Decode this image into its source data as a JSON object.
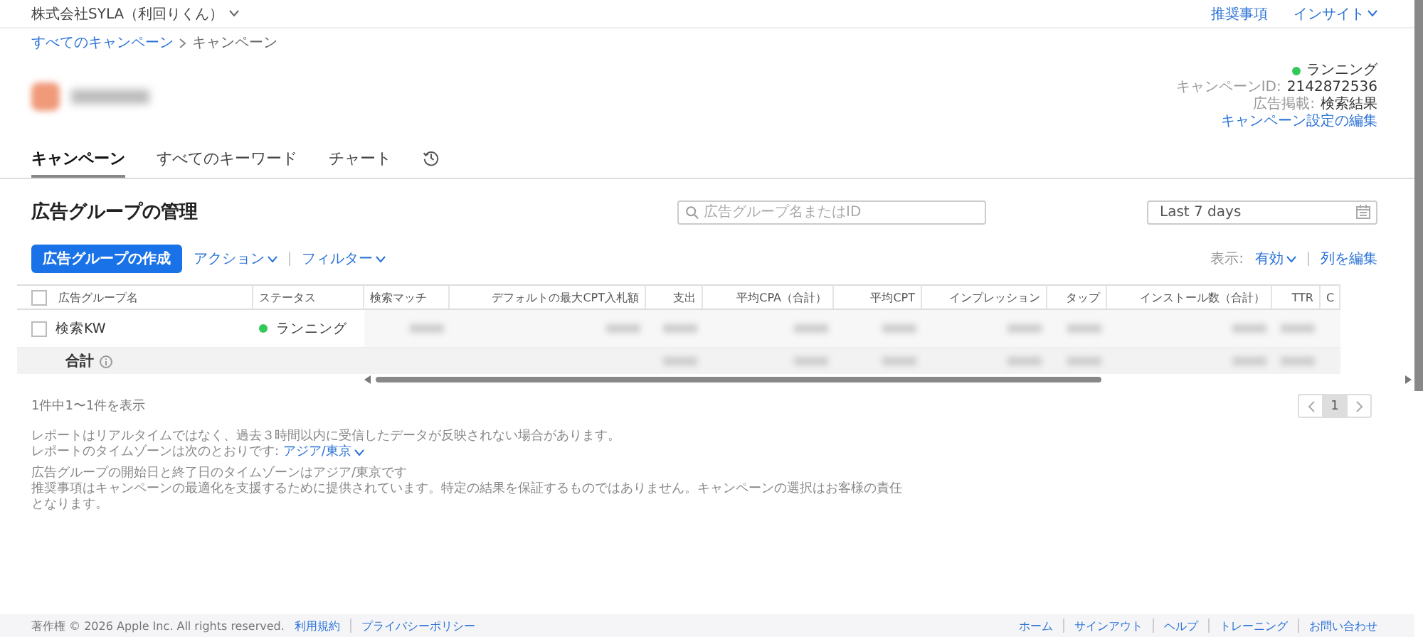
{
  "header": {
    "account": "株式会社SYLA（利回りくん）",
    "links": [
      {
        "label": "推奨事項",
        "kind": "link"
      },
      {
        "label": "インサイト",
        "kind": "menu"
      }
    ]
  },
  "breadcrumb": [
    "すべてのキャンペーン",
    "キャンペーン"
  ],
  "campaign": {
    "status": "ランニング",
    "id_label": "キャンペーンID:",
    "id": "2142872536",
    "type_label": "広告掲載:",
    "type": "検索結果",
    "edit_link": "キャンペーン設定の編集"
  },
  "tabs": [
    {
      "kind": "text",
      "label": "キャンペーン",
      "selected": true
    },
    {
      "kind": "text",
      "label": "すべてのキーワード",
      "selected": false
    },
    {
      "kind": "text",
      "label": "チャート",
      "selected": false
    },
    {
      "kind": "history",
      "selected": false
    }
  ],
  "section": {
    "title": "広告グループの管理",
    "search": {
      "placeholder": "広告グループ名またはID"
    },
    "date_range": "Last 7 days"
  },
  "toolbar": {
    "create_button": "広告グループの作成",
    "menus": [
      "アクション",
      "フィルター"
    ],
    "view_label": "表示:",
    "view_value": "有効",
    "edit_columns": "列を編集"
  },
  "table": {
    "select_all_checked": false,
    "columns": [
      "広告グループ名",
      "ステータス",
      "検索マッチ",
      "デフォルトの最大CPT入札額",
      "支出",
      "平均CPA（合計）",
      "平均CPT",
      "インプレッション",
      "タップ",
      "インストール数（合計）",
      "TTR",
      "C"
    ],
    "rows": [
      {
        "checked": false,
        "name": "検索KW",
        "status": "ランニング"
      }
    ],
    "total_label": "合計"
  },
  "result_count": "1件中1〜1件を表示",
  "notes": [
    {
      "lines": [
        "レポートはリアルタイムではなく、過去３時間以内に受信したデータが反映されない場合があります。"
      ],
      "timezone_label": "レポートのタイムゾーンは次のとおりです:",
      "timezone": "アジア/東京"
    },
    {
      "lines": [
        "広告グループの開始日と終了日のタイムゾーンはアジア/東京です",
        "推奨事項はキャンペーンの最適化を支援するために提供されています。特定の結果を保証するものではありません。キャンペーンの選択はお客様の責任となります。"
      ]
    }
  ],
  "pagination": [
    {
      "label": "1",
      "selected": true
    }
  ],
  "footer": {
    "copyright": "著作権 © 2026 Apple Inc. All rights reserved.",
    "left_links": [
      "利用規約",
      "プライバシーポリシー"
    ],
    "right_links": [
      "ホーム",
      "サインアウト",
      "ヘルプ",
      "トレーニング",
      "お問い合わせ"
    ]
  }
}
